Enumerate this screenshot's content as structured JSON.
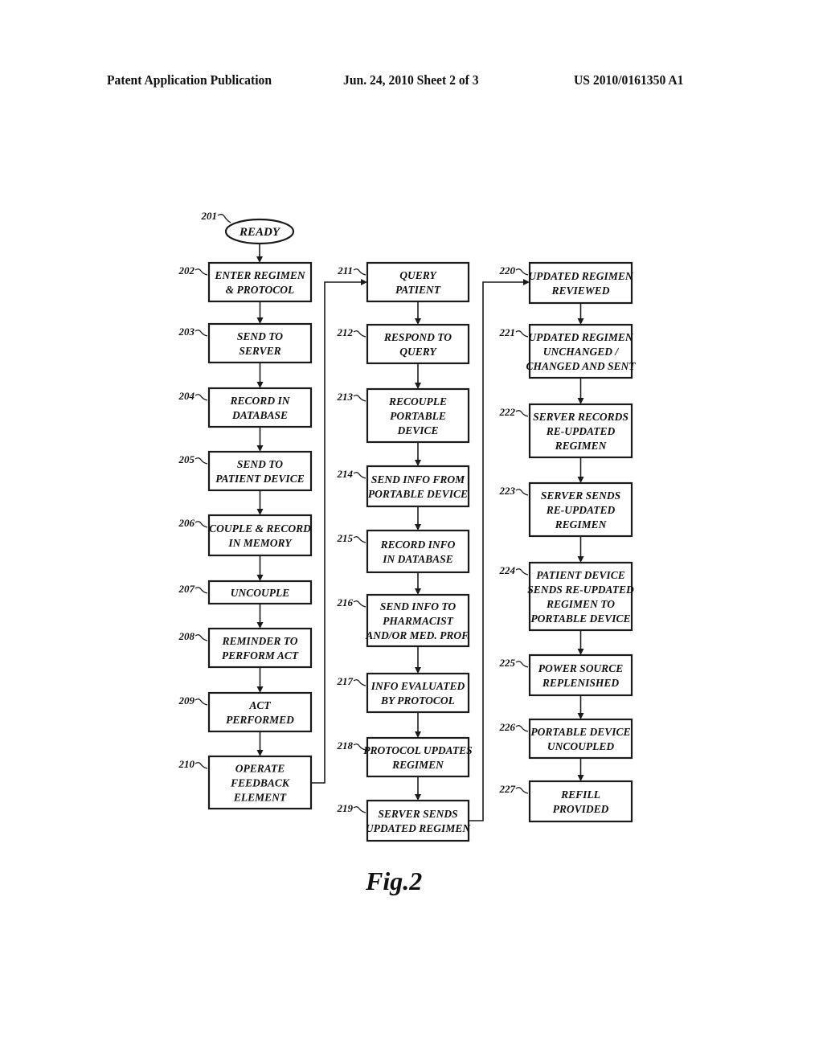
{
  "header": {
    "publication": "Patent Application Publication",
    "date_sheet": "Jun. 24, 2010  Sheet 2 of 3",
    "patent_number": "US 2010/0161350 A1"
  },
  "figure_label": "Fig.2",
  "start": {
    "ref": "201",
    "label": "READY"
  },
  "columns": [
    {
      "steps": [
        {
          "ref": "202",
          "lines": [
            "ENTER REGIMEN",
            "& PROTOCOL"
          ]
        },
        {
          "ref": "203",
          "lines": [
            "SEND TO",
            "SERVER"
          ]
        },
        {
          "ref": "204",
          "lines": [
            "RECORD IN",
            "DATABASE"
          ]
        },
        {
          "ref": "205",
          "lines": [
            "SEND TO",
            "PATIENT DEVICE"
          ]
        },
        {
          "ref": "206",
          "lines": [
            "COUPLE & RECORD",
            "IN MEMORY"
          ]
        },
        {
          "ref": "207",
          "lines": [
            "UNCOUPLE"
          ]
        },
        {
          "ref": "208",
          "lines": [
            "REMINDER TO",
            "PERFORM ACT"
          ]
        },
        {
          "ref": "209",
          "lines": [
            "ACT",
            "PERFORMED"
          ]
        },
        {
          "ref": "210",
          "lines": [
            "OPERATE",
            "FEEDBACK",
            "ELEMENT"
          ]
        }
      ]
    },
    {
      "steps": [
        {
          "ref": "211",
          "lines": [
            "QUERY",
            "PATIENT"
          ]
        },
        {
          "ref": "212",
          "lines": [
            "RESPOND TO",
            "QUERY"
          ]
        },
        {
          "ref": "213",
          "lines": [
            "RECOUPLE",
            "PORTABLE",
            "DEVICE"
          ]
        },
        {
          "ref": "214",
          "lines": [
            "SEND INFO FROM",
            "PORTABLE DEVICE"
          ]
        },
        {
          "ref": "215",
          "lines": [
            "RECORD INFO",
            "IN DATABASE"
          ]
        },
        {
          "ref": "216",
          "lines": [
            "SEND INFO TO",
            "PHARMACIST",
            "AND/OR MED. PROF."
          ]
        },
        {
          "ref": "217",
          "lines": [
            "INFO EVALUATED",
            "BY PROTOCOL"
          ]
        },
        {
          "ref": "218",
          "lines": [
            "PROTOCOL UPDATES",
            "REGIMEN"
          ]
        },
        {
          "ref": "219",
          "lines": [
            "SERVER SENDS",
            "UPDATED REGIMEN"
          ]
        }
      ]
    },
    {
      "steps": [
        {
          "ref": "220",
          "lines": [
            "UPDATED REGIMEN",
            "REVIEWED"
          ]
        },
        {
          "ref": "221",
          "lines": [
            "UPDATED REGIMEN",
            "UNCHANGED /",
            "CHANGED AND SENT"
          ]
        },
        {
          "ref": "222",
          "lines": [
            "SERVER RECORDS",
            "RE-UPDATED",
            "REGIMEN"
          ]
        },
        {
          "ref": "223",
          "lines": [
            "SERVER SENDS",
            "RE-UPDATED",
            "REGIMEN"
          ]
        },
        {
          "ref": "224",
          "lines": [
            "PATIENT DEVICE",
            "SENDS RE-UPDATED",
            "REGIMEN TO",
            "PORTABLE DEVICE"
          ]
        },
        {
          "ref": "225",
          "lines": [
            "POWER SOURCE",
            "REPLENISHED"
          ]
        },
        {
          "ref": "226",
          "lines": [
            "PORTABLE DEVICE",
            "UNCOUPLED"
          ]
        },
        {
          "ref": "227",
          "lines": [
            "REFILL",
            "PROVIDED"
          ]
        }
      ]
    }
  ]
}
